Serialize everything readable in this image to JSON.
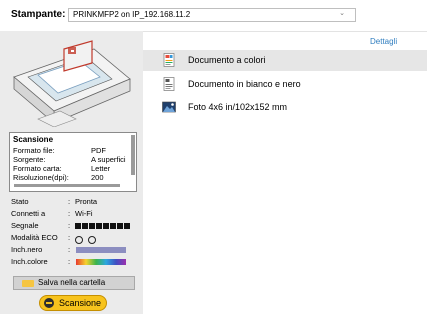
{
  "header": {
    "printer_label": "Stampante:",
    "printer_value": "PRINKMFP2 on IP_192.168.11.2"
  },
  "scan_info": {
    "title": "Scansione",
    "rows": [
      {
        "label": "Formato file:",
        "value": "PDF"
      },
      {
        "label": "Sorgente:",
        "value": "A superfici"
      },
      {
        "label": "Formato carta:",
        "value": "Letter"
      },
      {
        "label": "Risoluzione(dpi):",
        "value": "200"
      }
    ]
  },
  "status": {
    "stato": {
      "label": "Stato",
      "value": "Pronta"
    },
    "connection": {
      "label": "Connetti a",
      "value": "Wi-Fi"
    },
    "signal": {
      "label": "Segnale",
      "bars": 8
    },
    "eco": {
      "label": "Modalità ECO",
      "options": 2
    },
    "ink_black": {
      "label": "Inch.nero",
      "color": "#8c8ec0"
    },
    "ink_color": {
      "label": "Inch.colore"
    }
  },
  "actions": {
    "save_folder": "Salva nella cartella",
    "scan": "Scansione",
    "details": "Dettagli"
  },
  "scan_types": [
    {
      "label": "Documento a colori",
      "icon": "color-document-icon",
      "selected": true
    },
    {
      "label": "Documento in bianco e nero",
      "icon": "bw-document-icon",
      "selected": false
    },
    {
      "label": "Foto 4x6 in/102x152 mm",
      "icon": "photo-icon",
      "selected": false
    }
  ],
  "colors": {
    "accent_link": "#2f7dbf",
    "scan_button": "#f7c31d",
    "panel_bg": "#ebebeb",
    "selected_row": "#e6e6e6"
  }
}
